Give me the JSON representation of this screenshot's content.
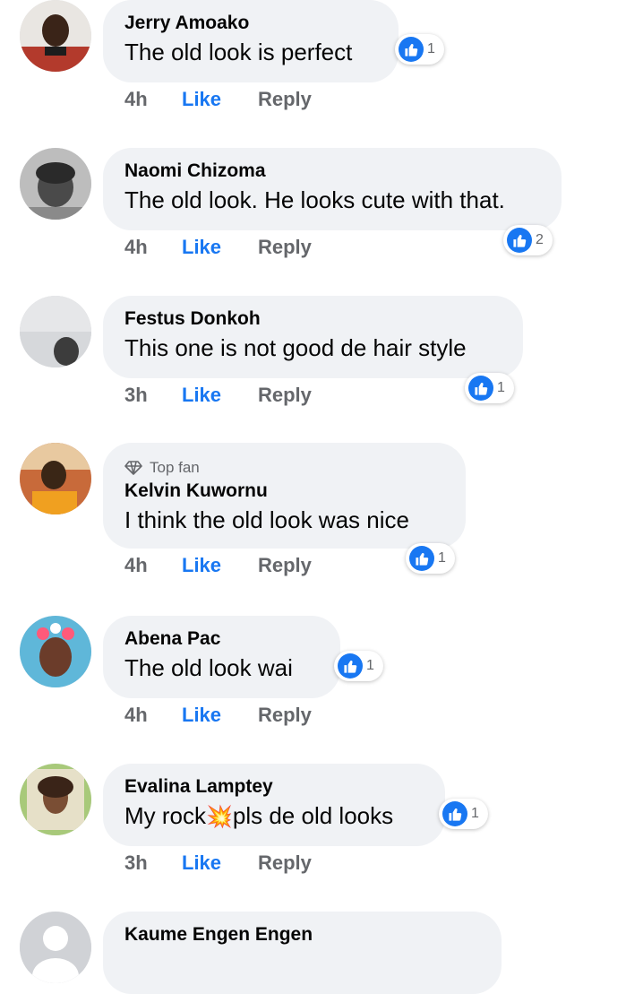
{
  "comments": [
    {
      "name": "Jerry Amoako",
      "text": "The old look is perfect",
      "time": "4h",
      "like": "Like",
      "reply": "Reply",
      "reactions": "1",
      "avatar_color": "#b33a2c"
    },
    {
      "name": "Naomi Chizoma",
      "text": "The old look. He looks cute with that.",
      "time": "4h",
      "like": "Like",
      "reply": "Reply",
      "reactions": "2",
      "avatar_color": "#6b6b6b"
    },
    {
      "name": "Festus Donkoh",
      "text": "This one is not good  de hair style",
      "time": "3h",
      "like": "Like",
      "reply": "Reply",
      "reactions": "1",
      "avatar_color": "#cfd2d6"
    },
    {
      "badge": "Top fan",
      "name": "Kelvin Kuwornu",
      "text": "I think the old look was nice",
      "time": "4h",
      "like": "Like",
      "reply": "Reply",
      "reactions": "1",
      "avatar_color": "#e0a030"
    },
    {
      "name": "Abena Pac",
      "text": "The old look  wai",
      "time": "4h",
      "like": "Like",
      "reply": "Reply",
      "reactions": "1",
      "avatar_color": "#5fb7d9"
    },
    {
      "name": "Evalina Lamptey",
      "text_before": "My rock",
      "emoji": "💥",
      "text_after": "pls de old looks",
      "time": "3h",
      "like": "Like",
      "reply": "Reply",
      "reactions": "1",
      "avatar_color": "#a8c97a"
    },
    {
      "name": "Kaume Engen Engen",
      "avatar_color": "#d0d2d6"
    }
  ],
  "colors": {
    "accent": "#1877f2",
    "bubble": "#f0f2f5",
    "muted": "#65676b"
  }
}
